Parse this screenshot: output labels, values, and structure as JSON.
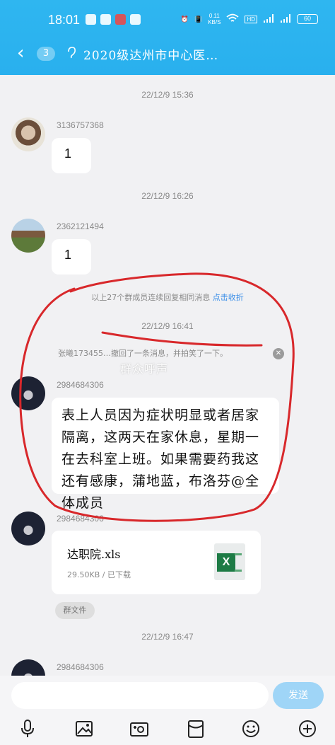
{
  "statusbar": {
    "time": "18:01",
    "net_speed_value": "0.11",
    "net_speed_unit": "KB/S",
    "battery": "60"
  },
  "header": {
    "badge": "3",
    "title": "2020级达州市中心医…"
  },
  "messages": {
    "ts1": "22/12/9 15:36",
    "sender1": "3136757368",
    "msg1": "1",
    "ts2": "22/12/9 16:26",
    "sender2": "2362121494",
    "msg2": "1",
    "notice_text": "以上27个群成员连续回复相同消息",
    "notice_link": "点击收折",
    "ts3": "22/12/9 16:41",
    "recall": "张曦173455…撤回了一条消息，并拍笑了一下。",
    "sender3": "2984684306",
    "msg3": "表上人员因为症状明显或者居家隔离，这两天在家休息，星期一在去科室上班。如果需要药我这还有感康，蒲地蓝，布洛芬@全体成员",
    "sender4": "2984684306",
    "file_name": "达职院.xls",
    "file_meta": "29.50KB / 已下载",
    "group_file_tag": "群文件",
    "ts4": "22/12/9 16:47",
    "sender5": "2984684306"
  },
  "input": {
    "placeholder": "",
    "send_label": "发送"
  },
  "watermark": "群众呼声",
  "colors": {
    "header_blue": "#2bb2ef",
    "annotation_red": "#d8282b",
    "link_blue": "#3a8ee8"
  }
}
